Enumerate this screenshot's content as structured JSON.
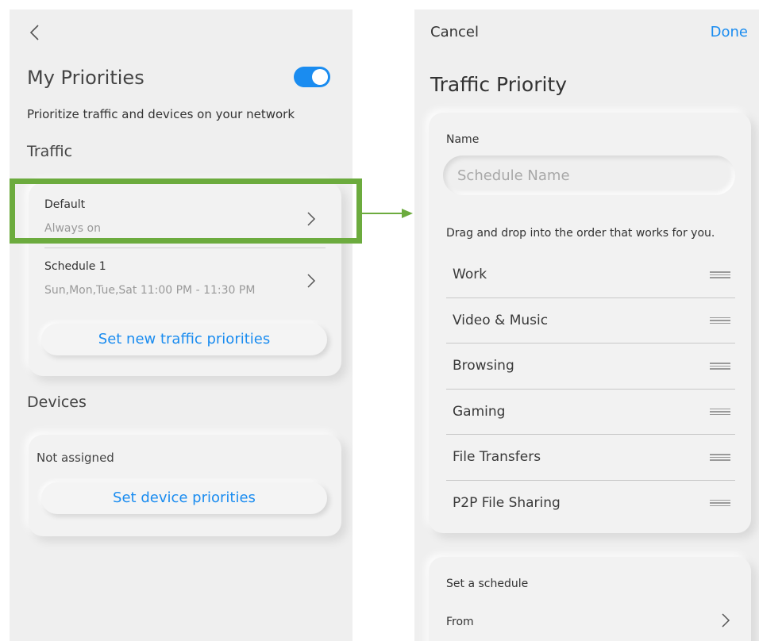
{
  "left": {
    "title": "My Priorities",
    "toggle_on": true,
    "subtitle": "Prioritize traffic and devices on your network",
    "traffic_heading": "Traffic",
    "schedules": [
      {
        "name": "Default",
        "time": "Always on"
      },
      {
        "name": "Schedule 1",
        "time": "Sun,Mon,Tue,Sat 11:00 PM - 11:30 PM"
      }
    ],
    "set_traffic_button": "Set new traffic priorities",
    "devices_heading": "Devices",
    "devices_status": "Not assigned",
    "set_device_button": "Set device priorities"
  },
  "right": {
    "cancel": "Cancel",
    "done": "Done",
    "title": "Traffic Priority",
    "name_label": "Name",
    "name_placeholder": "Schedule Name",
    "drag_hint": "Drag and drop into the order that works for you.",
    "priorities": [
      "Work",
      "Video & Music",
      "Browsing",
      "Gaming",
      "File Transfers",
      "P2P File Sharing"
    ],
    "schedule_label": "Set a schedule",
    "from_label": "From"
  },
  "colors": {
    "accent": "#1a8cf0",
    "highlight": "#6cab3e",
    "background": "#efefef"
  },
  "icons": [
    "chevron-left-icon",
    "chevron-right-icon",
    "drag-handle-icon",
    "toggle-switch"
  ]
}
